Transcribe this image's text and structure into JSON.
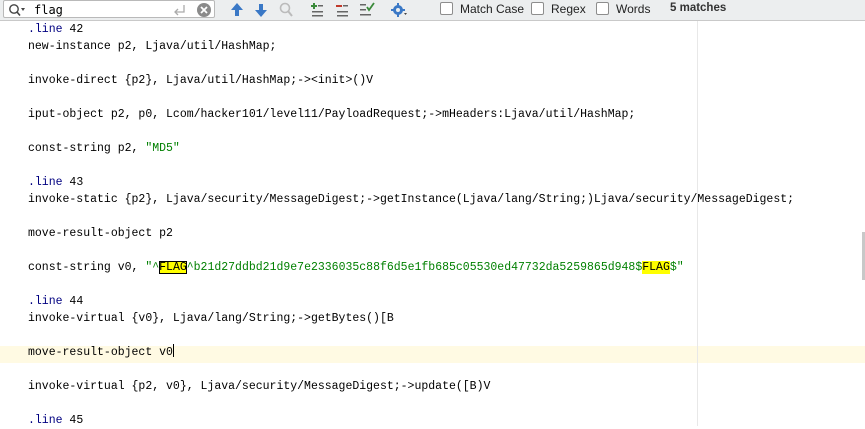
{
  "find": {
    "query": "flag",
    "match_case_label": "Match Case",
    "regex_label": "Regex",
    "words_label": "Words",
    "match_case_checked": false,
    "regex_checked": false,
    "words_checked": false,
    "matches_text": "5 matches"
  },
  "icons": {
    "search": "search-icon",
    "enter": "enter-icon",
    "clear": "clear-icon",
    "prev": "arrow-up-icon",
    "next": "arrow-down-icon",
    "find_all": "find-all-icon",
    "add_selection": "add-selection-icon",
    "remove_selection": "remove-selection-icon",
    "select_all": "select-all-occurrences-icon",
    "settings": "gear-icon"
  },
  "colors": {
    "keyword": "#000080",
    "string": "#008000",
    "highlight": "#ffff00",
    "current_line": "#fffae3"
  },
  "code": {
    "l1_kw": ".line",
    "l1_rest": " 42",
    "l2": "new-instance p2, Ljava/util/HashMap;",
    "l3": "",
    "l4": "invoke-direct {p2}, Ljava/util/HashMap;-><init>()V",
    "l5": "",
    "l6": "iput-object p2, p0, Lcom/hacker101/level11/PayloadRequest;->mHeaders:Ljava/util/HashMap;",
    "l7": "",
    "l8_pre": "const-string p2, ",
    "l8_str": "\"MD5\"",
    "l9": "",
    "l10_kw": ".line",
    "l10_rest": " 43",
    "l11": "invoke-static {p2}, Ljava/security/MessageDigest;->getInstance(Ljava/lang/String;)Ljava/security/MessageDigest;",
    "l12": "",
    "l13": "move-result-object p2",
    "l14": "",
    "l15_pre": "const-string v0, ",
    "l15_s1": "\"^",
    "l15_m1": "FLAG",
    "l15_s2": "^b21d27ddbd21d9e7e2336035c88f6d5e1fb685c05530ed47732da5259865d948$",
    "l15_m2": "FLAG",
    "l15_s3": "$\"",
    "l16": "",
    "l17_kw": ".line",
    "l17_rest": " 44",
    "l18": "invoke-virtual {v0}, Ljava/lang/String;->getBytes()[B",
    "l19": "",
    "l20": "move-result-object v0",
    "l21": "",
    "l22": "invoke-virtual {p2, v0}, Ljava/security/MessageDigest;->update([B)V",
    "l23": "",
    "l24_kw": ".line",
    "l24_rest": " 45"
  }
}
